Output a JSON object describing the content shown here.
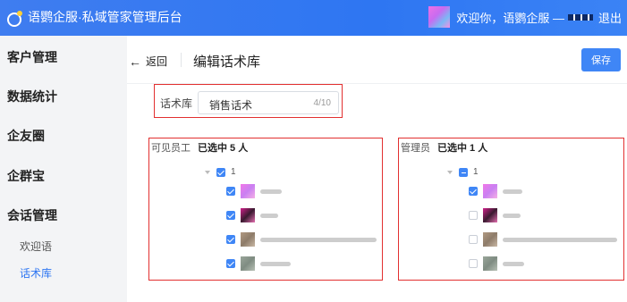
{
  "topbar": {
    "brand": "语鹦企服·私域管家管理后台",
    "welcome": "欢迎你，语鹦企服 —",
    "logout": "退出"
  },
  "sidebar": {
    "items": [
      "客户管理",
      "数据统计",
      "企友圈",
      "企群宝",
      "会话管理"
    ],
    "subitems": [
      "欢迎语",
      "话术库"
    ]
  },
  "header": {
    "back": "返回",
    "title": "编辑话术库",
    "save": "保存"
  },
  "library": {
    "label": "话术库",
    "value": "销售话术",
    "count": "4/10"
  },
  "visible_staff": {
    "title": "可见员工",
    "selected": "已选中 5 人",
    "group": "1"
  },
  "admins": {
    "title": "管理员",
    "selected": "已选中 1 人",
    "group": "1"
  }
}
